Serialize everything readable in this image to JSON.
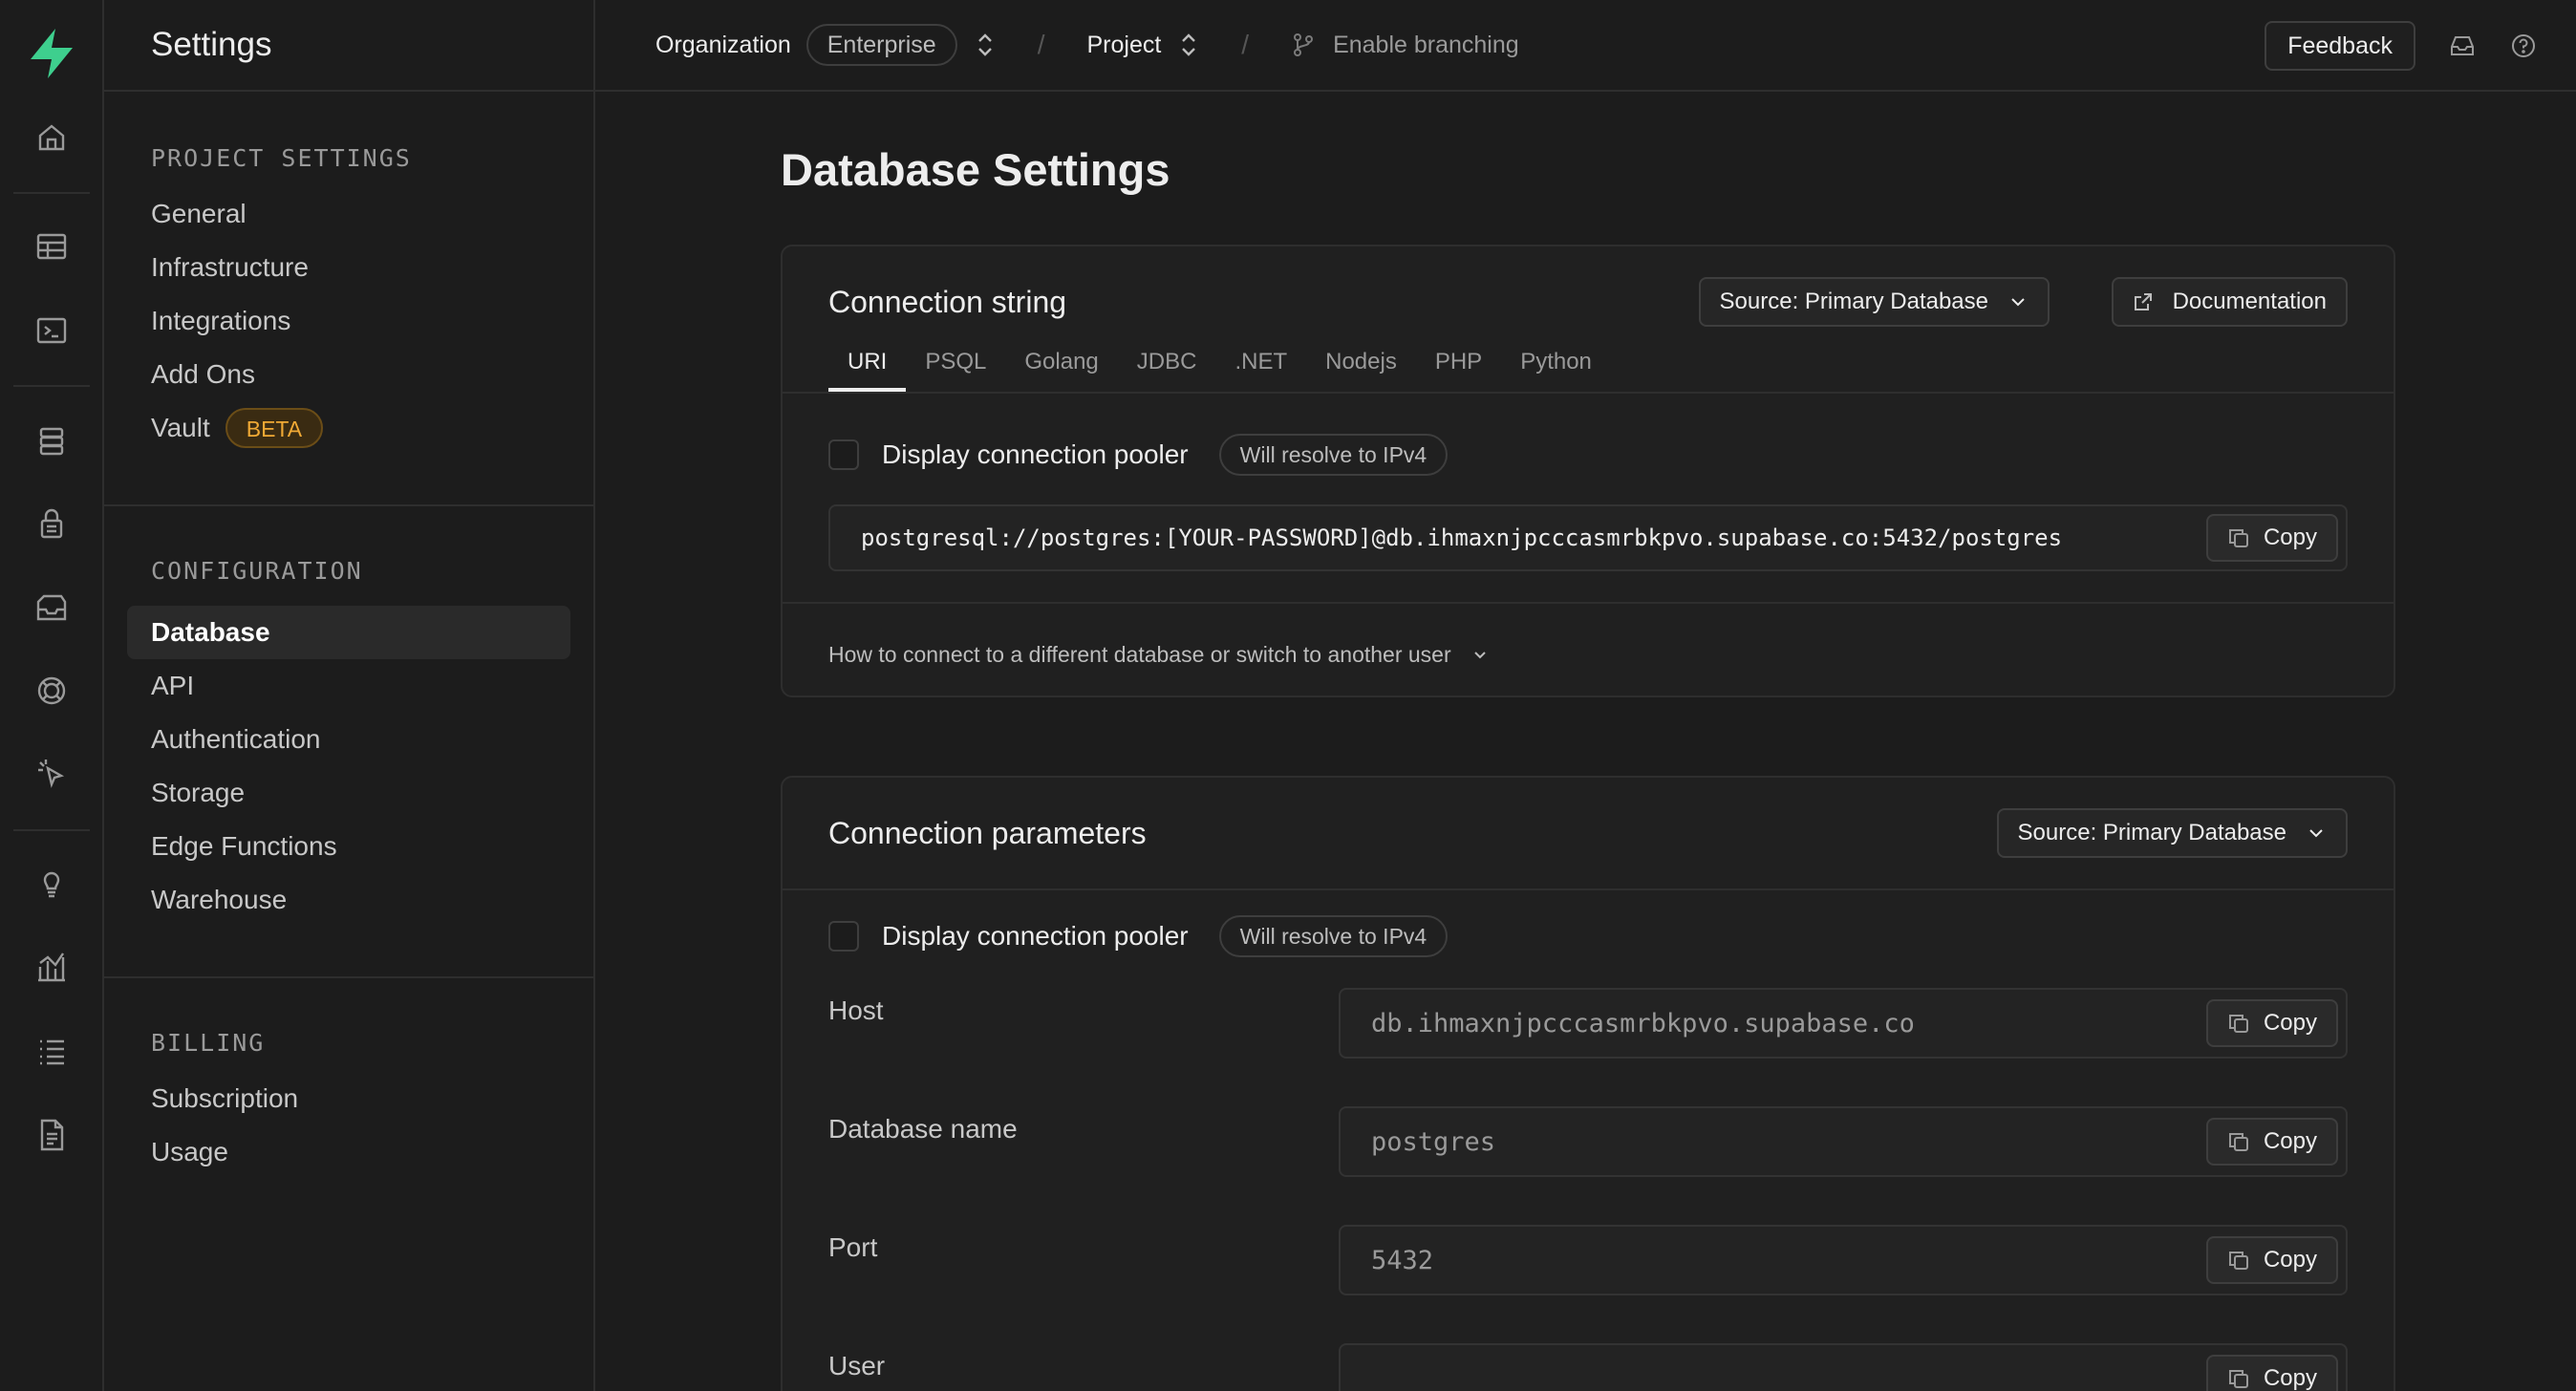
{
  "sidebar": {
    "title": "Settings",
    "groups": [
      {
        "title": "PROJECT SETTINGS",
        "items": [
          {
            "label": "General"
          },
          {
            "label": "Infrastructure"
          },
          {
            "label": "Integrations"
          },
          {
            "label": "Add Ons"
          },
          {
            "label": "Vault",
            "badge": "BETA"
          }
        ]
      },
      {
        "title": "CONFIGURATION",
        "items": [
          {
            "label": "Database",
            "active": true
          },
          {
            "label": "API"
          },
          {
            "label": "Authentication"
          },
          {
            "label": "Storage"
          },
          {
            "label": "Edge Functions"
          },
          {
            "label": "Warehouse"
          }
        ]
      },
      {
        "title": "BILLING",
        "items": [
          {
            "label": "Subscription"
          },
          {
            "label": "Usage"
          }
        ]
      }
    ]
  },
  "rail": {
    "icons": [
      "supabase-logo-icon",
      "home-icon",
      "table-editor-icon",
      "sql-editor-icon",
      "database-icon",
      "auth-lock-icon",
      "storage-icon",
      "realtime-icon",
      "edge-functions-icon",
      "advisors-bulb-icon",
      "reports-chart-icon",
      "logs-list-icon",
      "docs-page-icon"
    ]
  },
  "topbar": {
    "org_label": "Organization",
    "org_value": "Enterprise",
    "project_label": "Project",
    "branching_label": "Enable branching",
    "feedback_label": "Feedback"
  },
  "page": {
    "title": "Database Settings"
  },
  "connection_string": {
    "title": "Connection string",
    "source_label": "Source: Primary Database",
    "docs_label": "Documentation",
    "tabs": [
      "URI",
      "PSQL",
      "Golang",
      "JDBC",
      ".NET",
      "Nodejs",
      "PHP",
      "Python"
    ],
    "active_tab": "URI",
    "pooler_label": "Display connection pooler",
    "ipv4_label": "Will resolve to IPv4",
    "uri_value": "postgresql://postgres:[YOUR-PASSWORD]@db.ihmaxnjpcccasmrbkpvo.supabase.co:5432/postgres",
    "copy_label": "Copy",
    "howto_label": "How to connect to a different database or switch to another user"
  },
  "connection_params": {
    "title": "Connection parameters",
    "source_label": "Source: Primary Database",
    "pooler_label": "Display connection pooler",
    "ipv4_label": "Will resolve to IPv4",
    "copy_label": "Copy",
    "rows": [
      {
        "label": "Host",
        "value": "db.ihmaxnjpcccasmrbkpvo.supabase.co"
      },
      {
        "label": "Database name",
        "value": "postgres"
      },
      {
        "label": "Port",
        "value": "5432"
      },
      {
        "label": "User",
        "value": ""
      }
    ]
  },
  "colors": {
    "background": "#1c1c1c",
    "accent_green": "#3ecf8e",
    "beta_badge": "#f0a935"
  }
}
